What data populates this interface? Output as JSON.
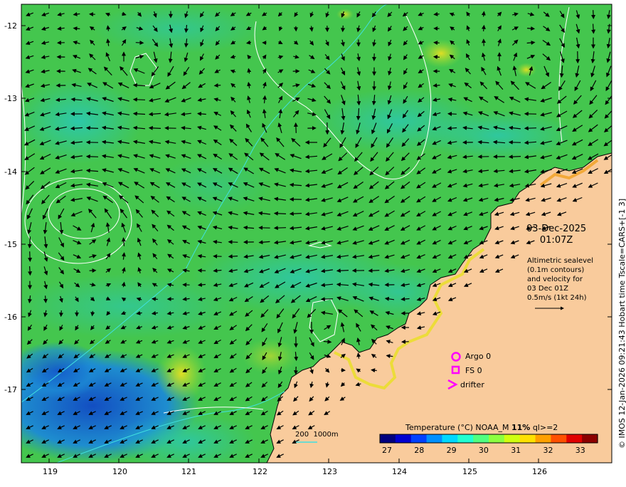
{
  "map": {
    "latitude_ticks": [
      "-12",
      "-13",
      "-14",
      "-15",
      "-16",
      "-17"
    ],
    "longitude_ticks": [
      "119",
      "120",
      "121",
      "122",
      "123",
      "124",
      "125",
      "126"
    ],
    "date": "03-Dec-2025",
    "time": "01:07Z",
    "description_lines": [
      "Altimetric sealevel",
      "(0.1m contours)",
      "and velocity for",
      "03 Dec 01Z",
      "0.5m/s (1kt 24h)"
    ],
    "contour_key": {
      "label_a": "200",
      "label_b": "1000m"
    },
    "credit": "© IMOS 12-Jan-2026 09:21:43 Hobart time Tscale=CARS+[-1 3]"
  },
  "legend": {
    "argo": "Argo 0",
    "fs": "FS 0",
    "drifter": "drifter"
  },
  "colorbar": {
    "title_prefix": "Temperature (°C) NOAA_M ",
    "title_bold": "11%",
    "title_suffix": " ql>=2",
    "tick_labels": [
      "27",
      "28",
      "29",
      "30",
      "31",
      "32",
      "33"
    ],
    "colors": [
      "#00007f",
      "#0000d0",
      "#0040ff",
      "#0090ff",
      "#00d8ff",
      "#20ffd0",
      "#50ff80",
      "#8cff40",
      "#d0ff10",
      "#ffe000",
      "#ffa000",
      "#ff5000",
      "#e00000",
      "#8c0000"
    ]
  },
  "colors": {
    "land": "#f9cb9c",
    "ocean_main": "#42c850",
    "ocean_cool": "#26c8c0",
    "ocean_cold": "#1c6fd6",
    "warm": "#f0e020",
    "hot": "#f07020",
    "contour": "#ffffff",
    "isobath": "#40e0e0",
    "marker": "#ff00ff"
  }
}
